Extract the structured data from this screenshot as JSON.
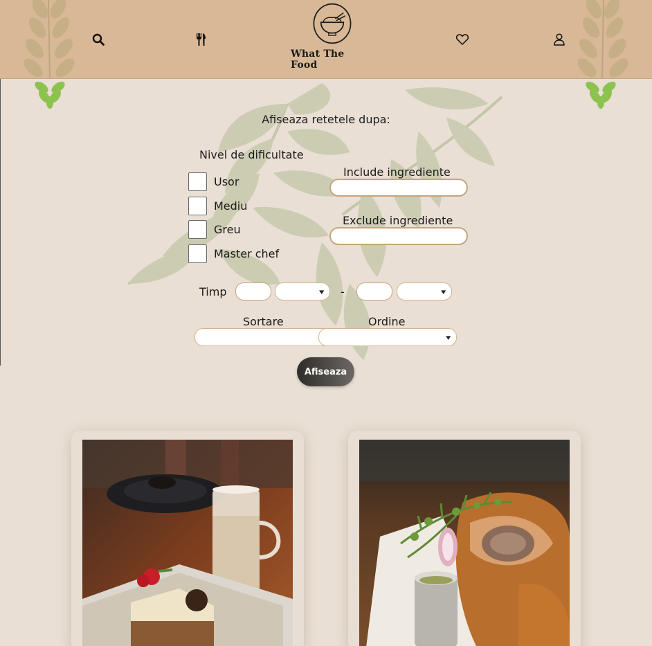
{
  "header": {
    "brand": "What The Food",
    "icons": [
      "search-icon",
      "utensils-icon",
      "bowl-logo",
      "heart-icon",
      "user-icon"
    ]
  },
  "filters": {
    "title": "Afiseaza retetele dupa:",
    "difficulty": {
      "label": "Nivel de dificultate",
      "options": [
        "Usor",
        "Mediu",
        "Greu",
        "Master chef"
      ]
    },
    "include": {
      "label": "Include ingrediente",
      "value": ""
    },
    "exclude": {
      "label": "Exclude ingrediente",
      "value": ""
    },
    "time": {
      "label": "Timp",
      "separator": "-"
    },
    "sort": {
      "label": "Sortare"
    },
    "order": {
      "label": "Ordine"
    },
    "submit_label": "Afiseaza"
  },
  "colors": {
    "background": "#e9dfd4",
    "header": "#d8b896",
    "accent_border": "#c5a57d",
    "button_dark": "#2e2b29"
  }
}
